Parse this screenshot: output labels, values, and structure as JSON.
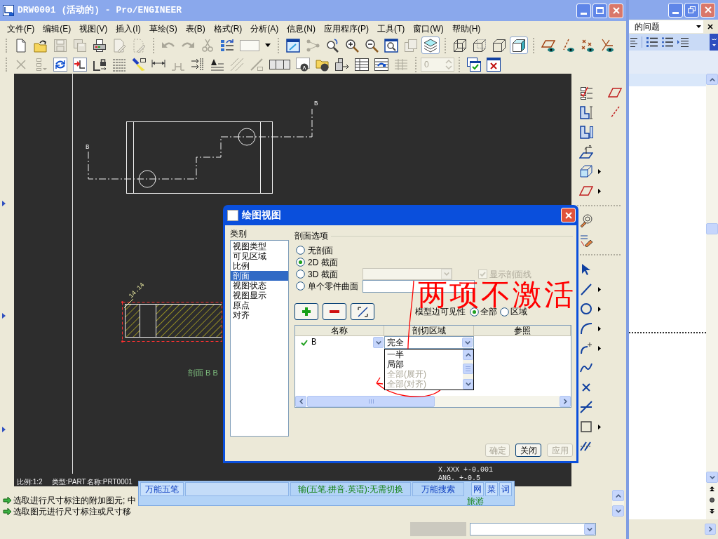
{
  "window": {
    "title": "DRW0001 (活动的) - Pro/ENGINEER"
  },
  "menu": [
    "文件(F)",
    "编辑(E)",
    "视图(V)",
    "插入(I)",
    "草绘(S)",
    "表(B)",
    "格式(R)",
    "分析(A)",
    "信息(N)",
    "应用程序(P)",
    "工具(T)",
    "窗口(W)",
    "帮助(H)"
  ],
  "toolbar_1": [
    {
      "disabled": false,
      "pressed": false
    },
    {
      "disabled": false,
      "pressed": false
    },
    {
      "disabled": true,
      "pressed": false
    },
    {
      "disabled": true,
      "pressed": false
    },
    {
      "disabled": false,
      "pressed": false
    },
    {
      "disabled": true,
      "pressed": false
    },
    {
      "disabled": true,
      "pressed": false
    },
    {
      "disabled": true,
      "pressed": false
    },
    {
      "disabled": true,
      "pressed": false
    },
    {
      "disabled": true,
      "pressed": false
    },
    {
      "disabled": false,
      "pressed": false
    },
    {
      "disabled": false,
      "pressed": false
    },
    {
      "disabled": false,
      "pressed": false
    },
    {
      "disabled": false,
      "pressed": false
    },
    {
      "disabled": true,
      "pressed": false
    },
    {
      "disabled": false,
      "pressed": false
    },
    {
      "disabled": false,
      "pressed": false
    },
    {
      "disabled": false,
      "pressed": false
    },
    {
      "disabled": false,
      "pressed": false
    },
    {
      "disabled": true,
      "pressed": false
    },
    {
      "disabled": false,
      "pressed": true
    },
    {
      "disabled": false,
      "pressed": false
    },
    {
      "disabled": false,
      "pressed": false
    },
    {
      "disabled": false,
      "pressed": false
    },
    {
      "disabled": false,
      "pressed": true
    },
    {
      "disabled": false,
      "pressed": false
    },
    {
      "disabled": false,
      "pressed": false
    },
    {
      "disabled": false,
      "pressed": false
    },
    {
      "disabled": false,
      "pressed": false
    }
  ],
  "toolbar_2": [
    {
      "disabled": true
    },
    {
      "disabled": true
    },
    {
      "disabled": false
    },
    {
      "disabled": false
    },
    {
      "disabled": false
    },
    {
      "disabled": false
    },
    {
      "disabled": false
    },
    {
      "disabled": false
    },
    {
      "disabled": true
    },
    {
      "disabled": false
    },
    {
      "disabled": false
    },
    {
      "disabled": true
    },
    {
      "disabled": true
    },
    {
      "disabled": false
    },
    {
      "disabled": false
    },
    {
      "disabled": false
    },
    {
      "disabled": false
    },
    {
      "disabled": false
    },
    {
      "disabled": false
    },
    {
      "disabled": true
    },
    {
      "disabled": false
    },
    {
      "disabled": false
    }
  ],
  "spin_field": {
    "value": "0",
    "disabled": true
  },
  "drawing": {
    "section_labels": [
      "B",
      "B"
    ],
    "dimension": "14.14",
    "view_caption": "剖面 B B",
    "sheet_info": [
      "比例:1:2",
      "类型:PART",
      "名称:PRT0001"
    ],
    "tolerances": [
      "X.XXX +-0.001",
      "ANG. +-0.5"
    ]
  },
  "messages": [
    "选取进行尺寸标注的附加图元; 中",
    "选取图元进行尺寸标注或尺寸移"
  ],
  "dialog": {
    "title": "绘图视图",
    "category_label": "类别",
    "categories": [
      {
        "label": "视图类型",
        "selected": false
      },
      {
        "label": "可见区域",
        "selected": false
      },
      {
        "label": "比例",
        "selected": false
      },
      {
        "label": "剖面",
        "selected": true
      },
      {
        "label": "视图状态",
        "selected": false
      },
      {
        "label": "视图显示",
        "selected": false
      },
      {
        "label": "原点",
        "selected": false
      },
      {
        "label": "对齐",
        "selected": false
      }
    ],
    "group_title": "剖面选项",
    "section_options": [
      {
        "label": "无剖面",
        "selected": false
      },
      {
        "label": "2D 截面",
        "selected": true
      },
      {
        "label": "3D 截面",
        "selected": false
      },
      {
        "label": "单个零件曲面",
        "selected": false
      }
    ],
    "section_dropdown": {
      "disabled": true
    },
    "show_hatching": {
      "label": "显示剖面线",
      "checked": true,
      "disabled": true
    },
    "edge_visibility": {
      "label": "模型边可见性",
      "options": [
        {
          "label": "全部",
          "selected": true
        },
        {
          "label": "区域",
          "selected": false
        }
      ]
    },
    "table": {
      "columns": [
        "名称",
        "剖切区域",
        "参照"
      ],
      "rows": [
        {
          "name": "B",
          "valid": true,
          "area": "完全"
        }
      ]
    },
    "area_options": [
      {
        "label": "一半",
        "disabled": false
      },
      {
        "label": "局部",
        "disabled": false
      },
      {
        "label": "全部(展开)",
        "disabled": true
      },
      {
        "label": "全部(对齐)",
        "disabled": true
      }
    ],
    "buttons": [
      {
        "label": "确定",
        "disabled": true
      },
      {
        "label": "关闭",
        "disabled": false
      },
      {
        "label": "应用",
        "disabled": true
      }
    ]
  },
  "annotation": {
    "handwriting": "两项不激活"
  },
  "ime_bar": {
    "name": "万能五笔",
    "mode": "输(五笔.拼音.英语):无需切换",
    "search": "万能搜索",
    "keys": [
      "网",
      "菜",
      "词"
    ],
    "link": "旅游"
  },
  "side_window": {
    "search_text": "的问题"
  }
}
